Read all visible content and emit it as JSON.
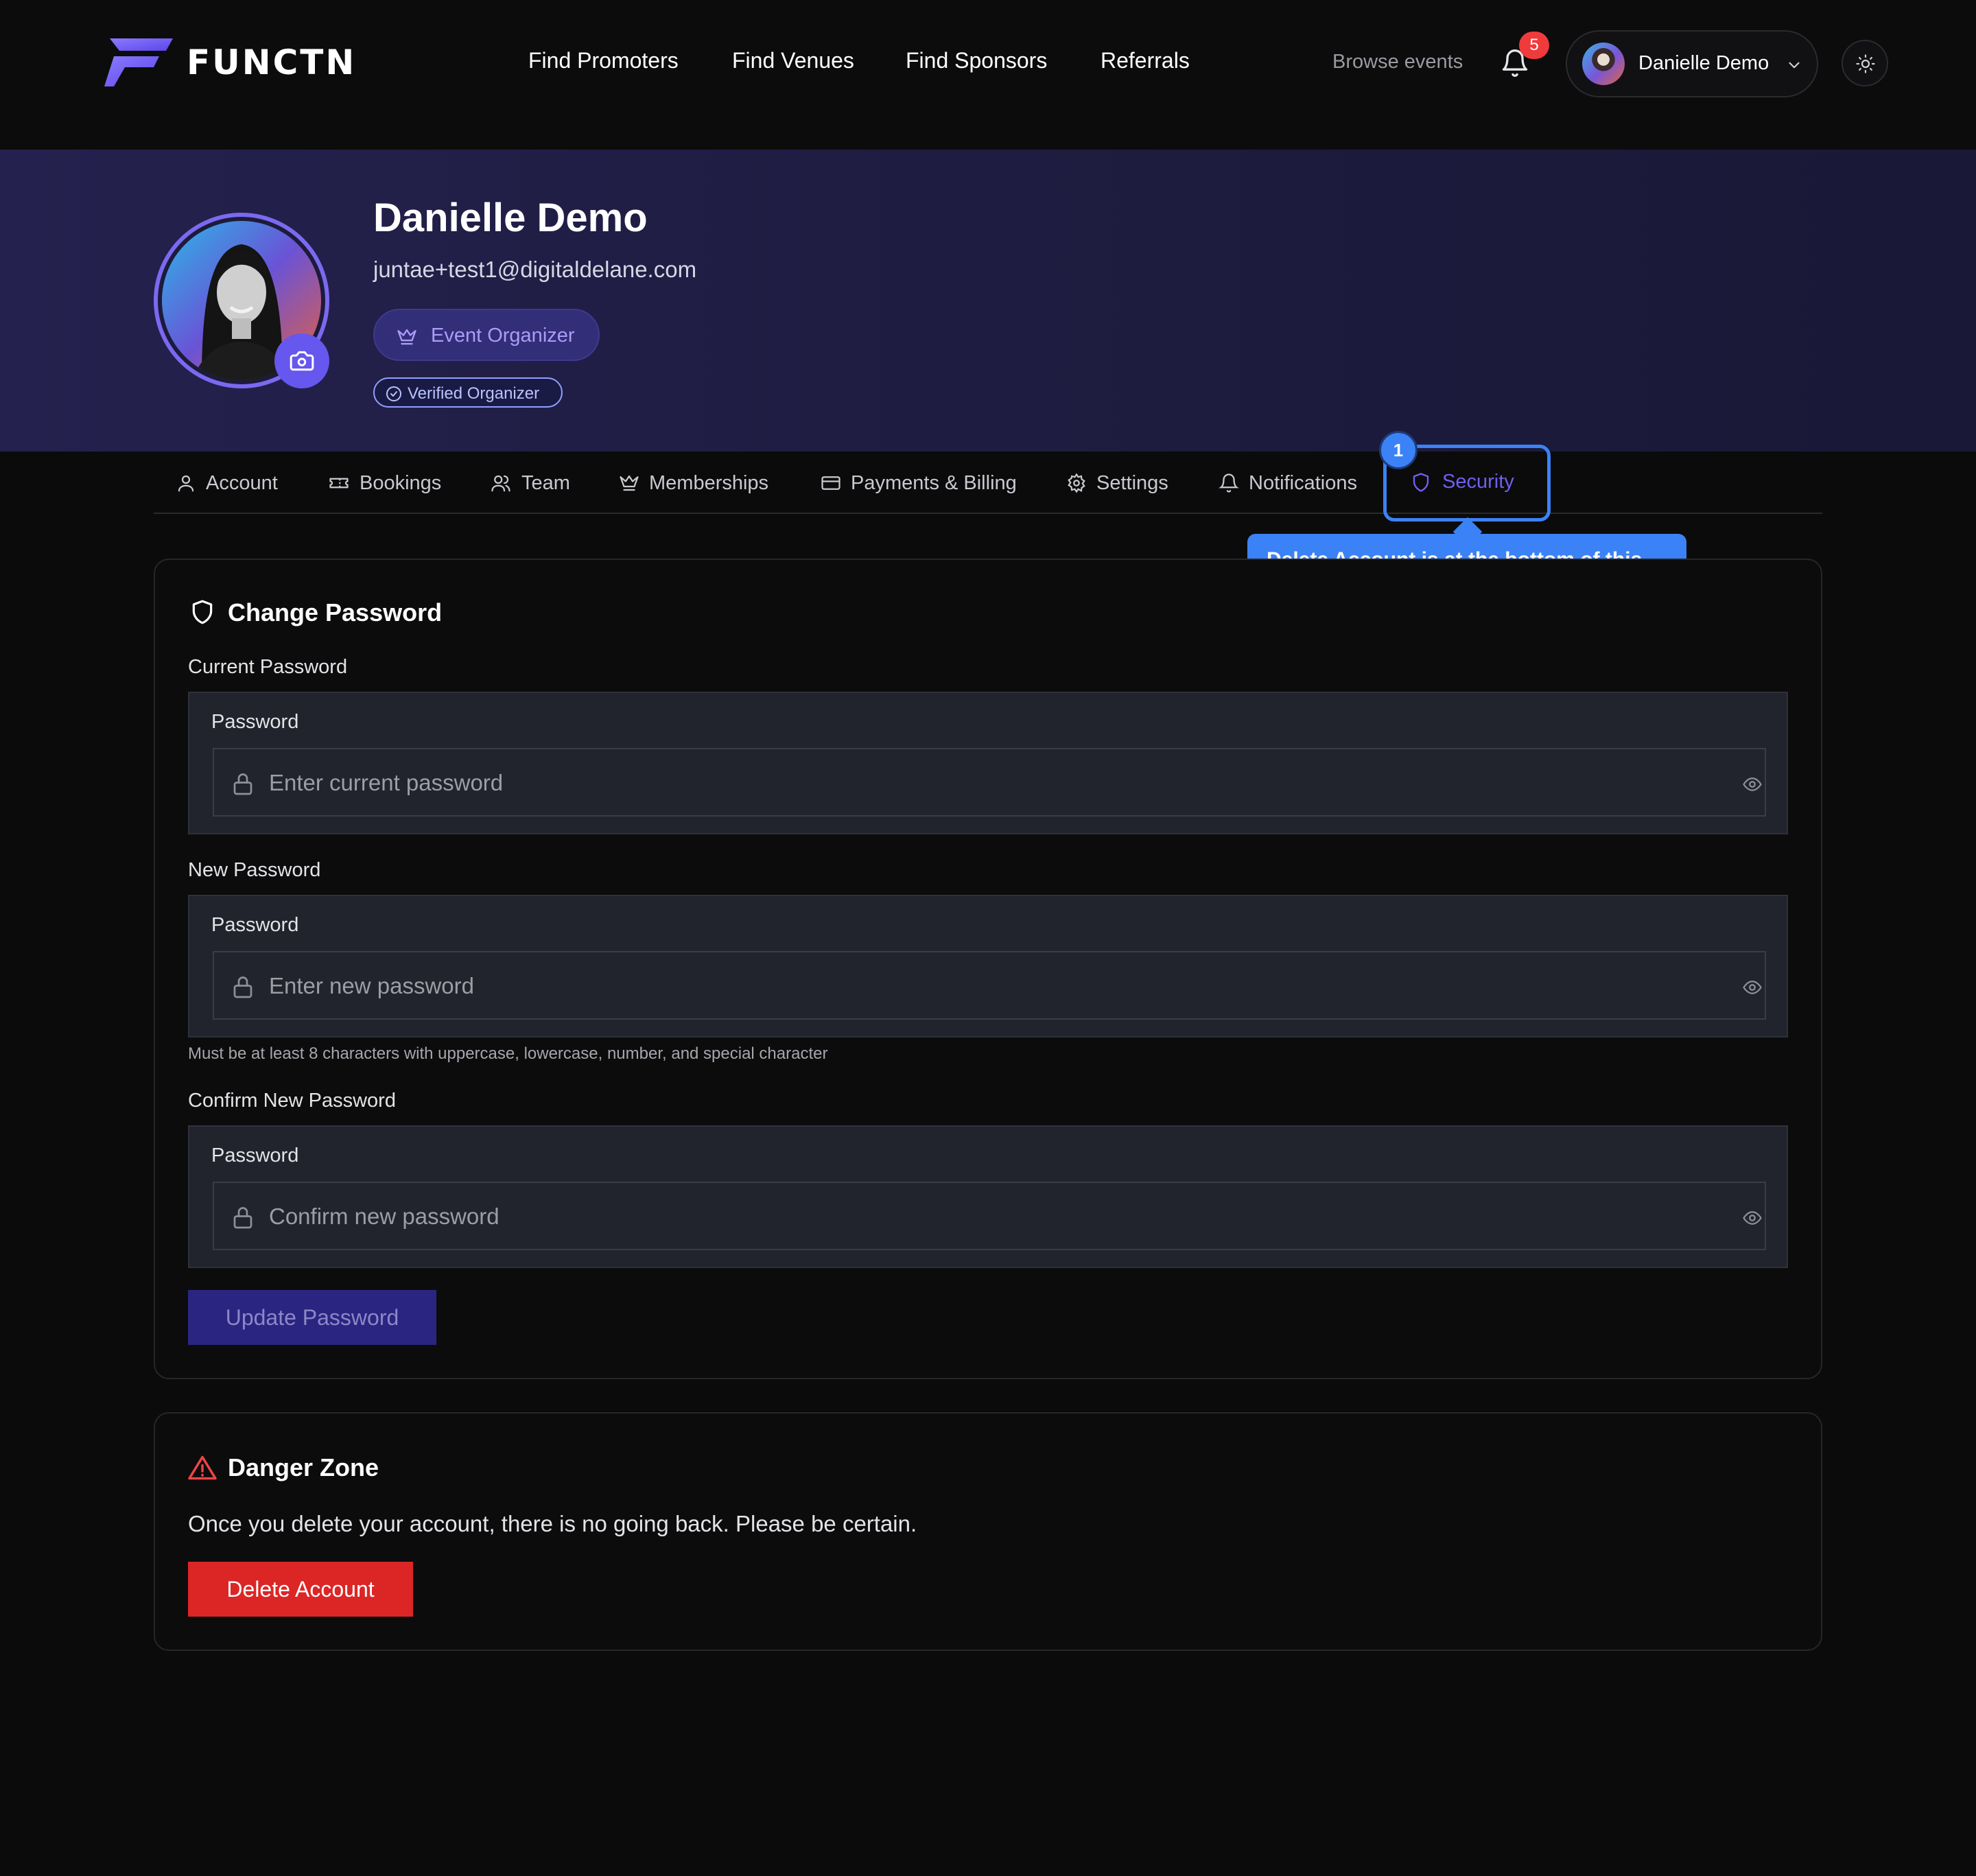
{
  "brand": {
    "name": "FUNCTN",
    "accent": "#6657ee"
  },
  "nav": {
    "links": [
      "Find Promoters",
      "Find Venues",
      "Find Sponsors",
      "Referrals"
    ],
    "browse_events": "Browse events",
    "notification_count": "5",
    "user_name": "Danielle Demo"
  },
  "profile": {
    "name": "Danielle Demo",
    "email": "juntae+test1@digitaldelane.com",
    "role": "Event Organizer",
    "verified": "Verified Organizer"
  },
  "tabs": [
    {
      "label": "Account",
      "icon": "user-icon"
    },
    {
      "label": "Bookings",
      "icon": "ticket-icon"
    },
    {
      "label": "Team",
      "icon": "users-icon"
    },
    {
      "label": "Memberships",
      "icon": "crown-icon"
    },
    {
      "label": "Payments & Billing",
      "icon": "credit-card-icon"
    },
    {
      "label": "Settings",
      "icon": "gear-icon"
    },
    {
      "label": "Notifications",
      "icon": "bell-icon"
    },
    {
      "label": "Security",
      "icon": "shield-icon",
      "active": true
    }
  ],
  "annotation": {
    "step": "1",
    "tooltip": "Delete Account is at the bottom of this tab",
    "color": "#3b82f6"
  },
  "change_password": {
    "title": "Change Password",
    "current": {
      "label": "Current Password",
      "inner_label": "Password",
      "placeholder": "Enter current password"
    },
    "new": {
      "label": "New Password",
      "inner_label": "Password",
      "placeholder": "Enter new password"
    },
    "hint": "Must be at least 8 characters with uppercase, lowercase, number, and special character",
    "confirm": {
      "label": "Confirm New Password",
      "inner_label": "Password",
      "placeholder": "Confirm new password"
    },
    "button": "Update Password"
  },
  "danger_zone": {
    "title": "Danger Zone",
    "text": "Once you delete your account, there is no going back. Please be certain.",
    "button": "Delete Account",
    "color": "#dc2626"
  }
}
